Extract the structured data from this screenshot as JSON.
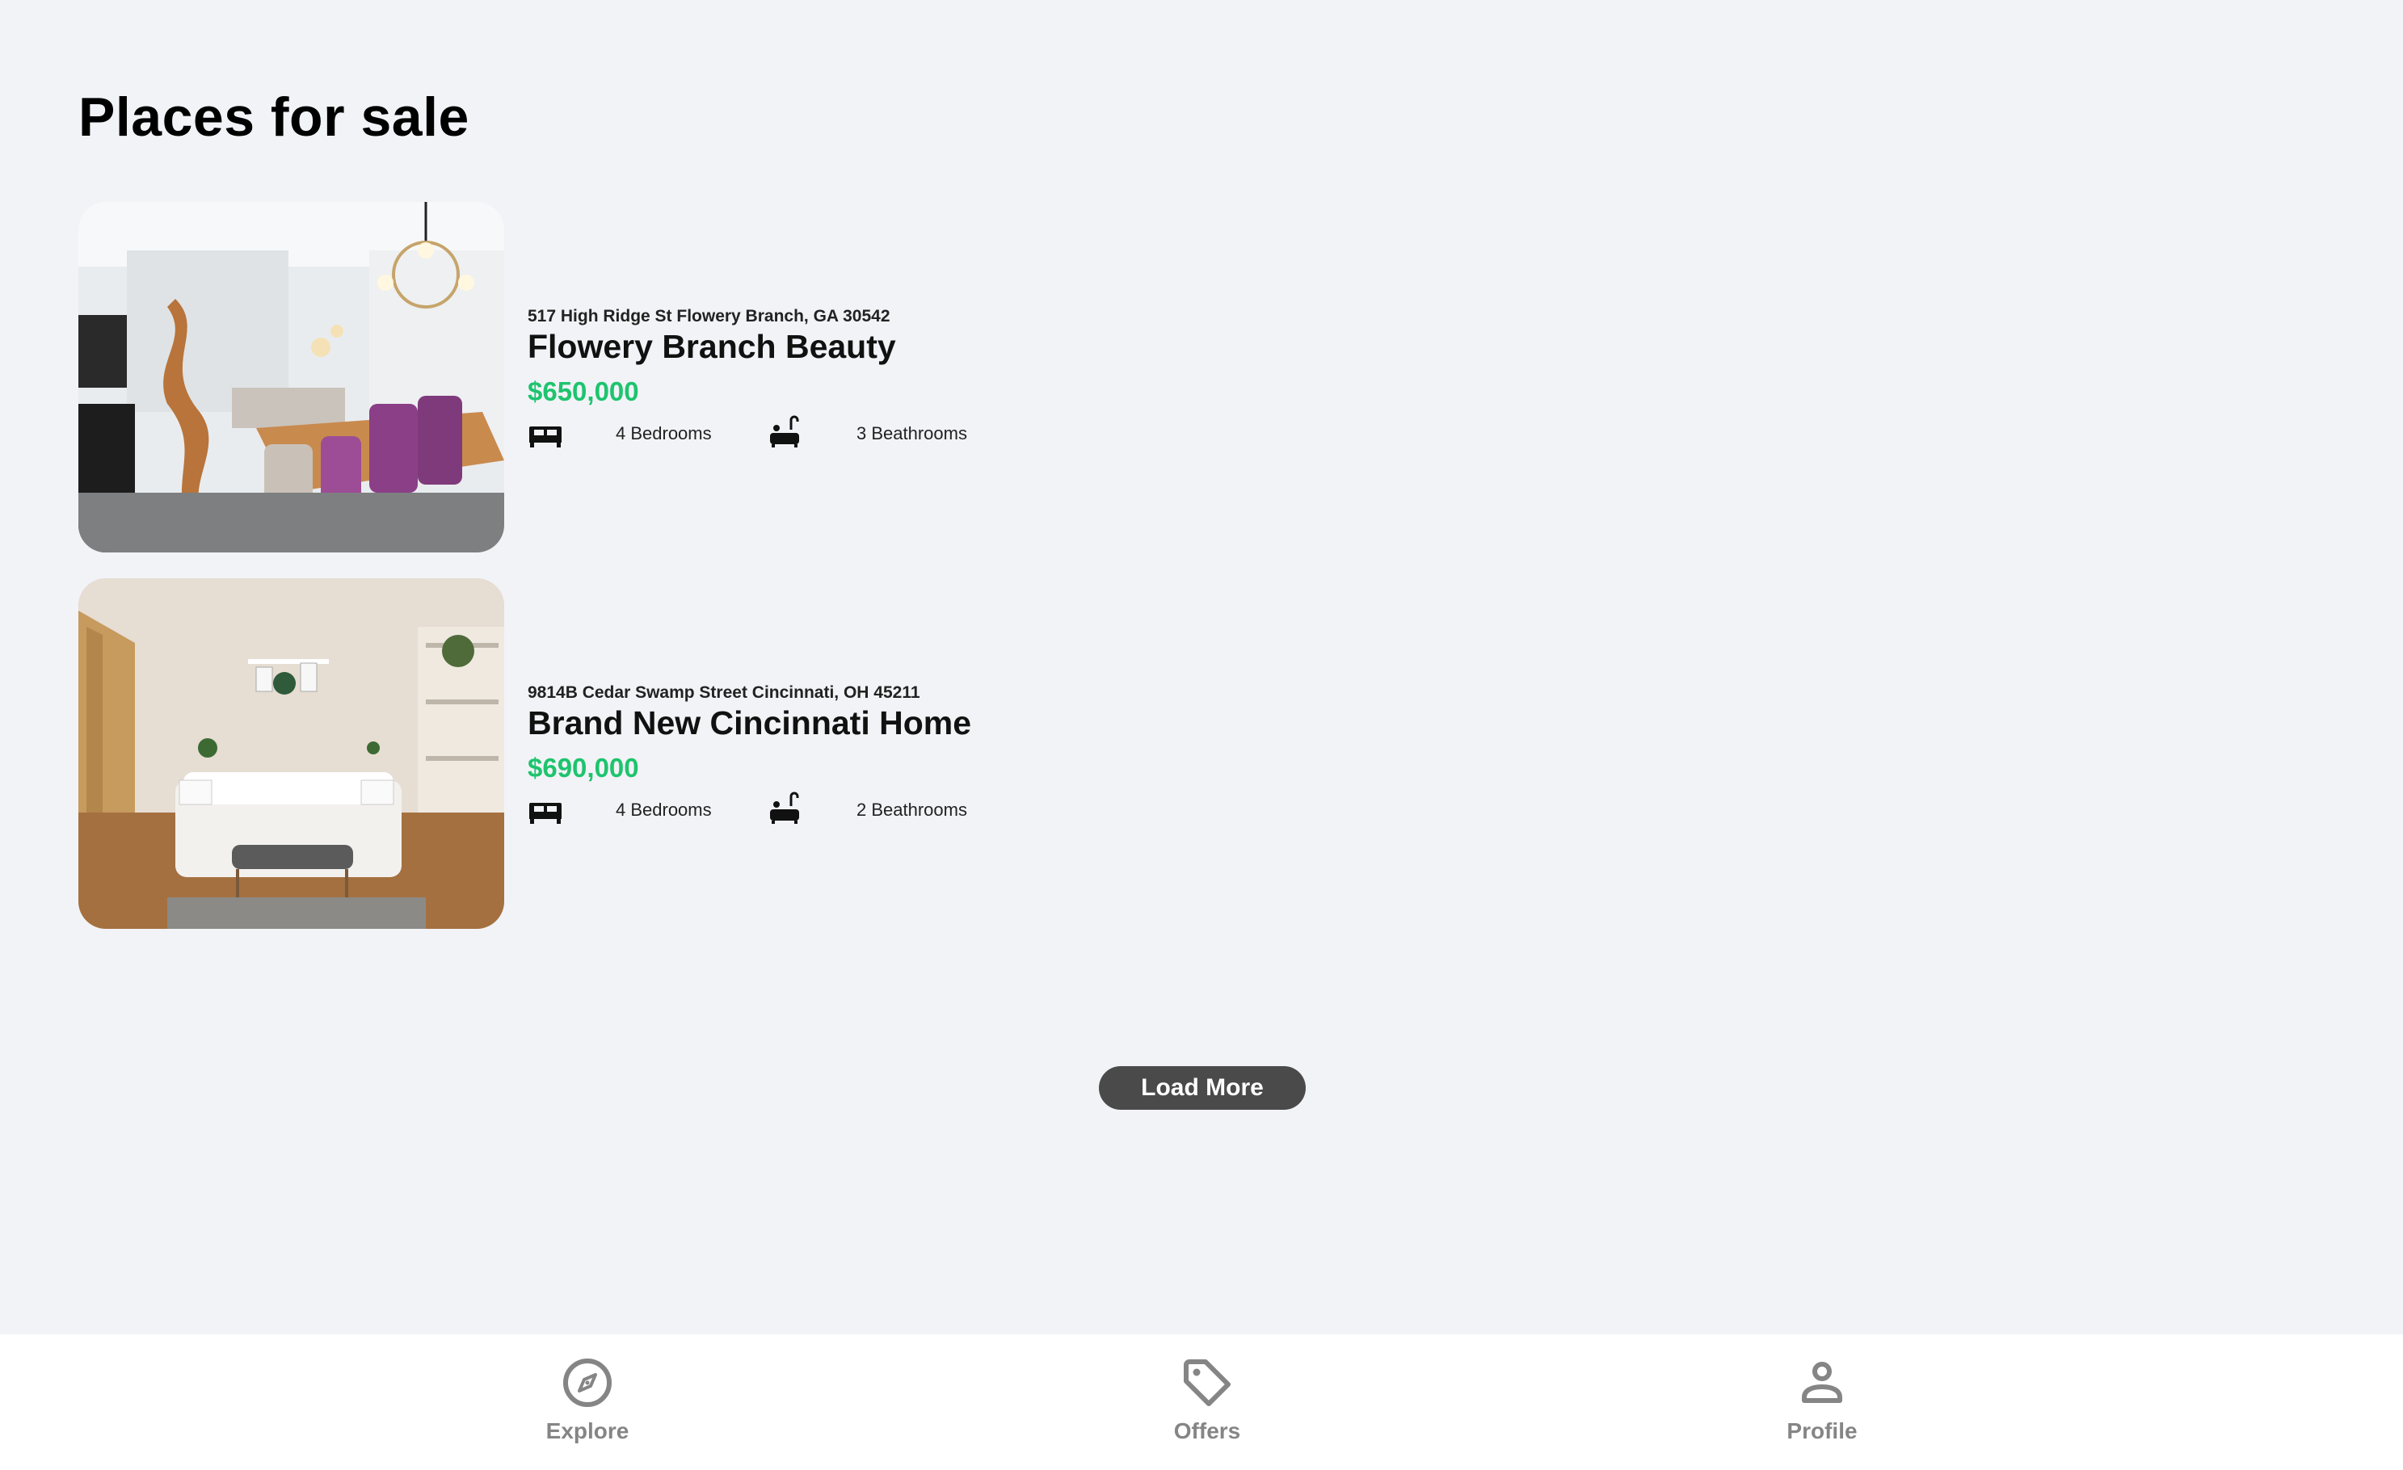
{
  "page": {
    "title": "Places for sale"
  },
  "listings": [
    {
      "address": "517 High Ridge St Flowery Branch, GA 30542",
      "name": "Flowery Branch Beauty",
      "price": "$650,000",
      "bedrooms": "4 Bedrooms",
      "bathrooms": "3 Beathrooms",
      "photo_icon": "dining-room-photo"
    },
    {
      "address": "9814B Cedar Swamp Street Cincinnati, OH 45211",
      "name": "Brand New Cincinnati Home",
      "price": "$690,000",
      "bedrooms": "4 Bedrooms",
      "bathrooms": "2 Beathrooms",
      "photo_icon": "bedroom-photo"
    }
  ],
  "actions": {
    "load_more": "Load More"
  },
  "nav": {
    "explore": {
      "label": "Explore",
      "icon": "compass-icon"
    },
    "offers": {
      "label": "Offers",
      "icon": "tag-icon"
    },
    "profile": {
      "label": "Profile",
      "icon": "person-icon"
    }
  },
  "colors": {
    "background": "#f2f3f7",
    "price": "#1ec46e",
    "button": "#4a4a4a",
    "nav_label": "#858585"
  }
}
